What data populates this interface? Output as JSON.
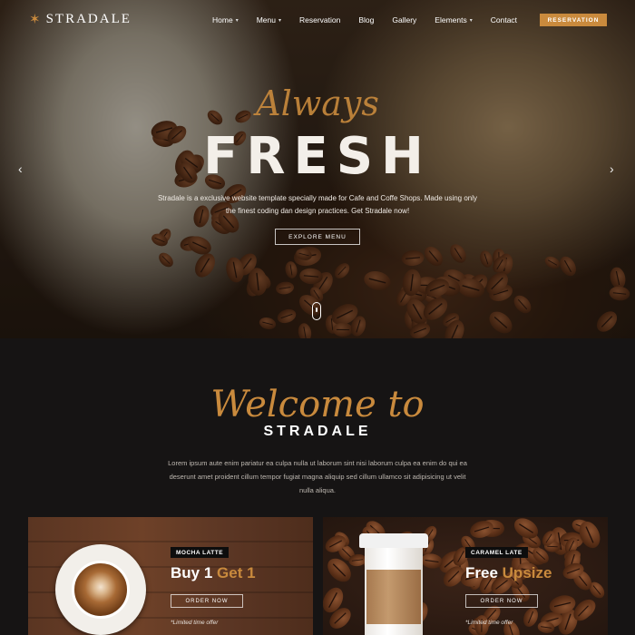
{
  "brand": {
    "name": "STRADALE"
  },
  "nav": {
    "items": [
      {
        "label": "Home",
        "dropdown": true
      },
      {
        "label": "Menu",
        "dropdown": true
      },
      {
        "label": "Reservation",
        "dropdown": false
      },
      {
        "label": "Blog",
        "dropdown": false
      },
      {
        "label": "Gallery",
        "dropdown": false
      },
      {
        "label": "Elements",
        "dropdown": true
      },
      {
        "label": "Contact",
        "dropdown": false
      }
    ],
    "cta_label": "RESERVATION"
  },
  "hero": {
    "script_word": "Always",
    "headline": "FRESH",
    "description": "Stradale is a exclusive website template specially made for Cafe and Coffe Shops. Made using only the finest coding dan design practices. Get Stradale now!",
    "button_label": "EXPLORE MENU"
  },
  "welcome": {
    "script_title": "Welcome to",
    "brand_title": "STRADALE",
    "text": "Lorem ipsum aute enim pariatur ea culpa nulla ut laborum sint nisi laborum culpa ea enim do qui ea deserunt amet proident cillum tempor fugiat magna aliquip sed cillum ullamco sit adipisicing ut velit nulla aliqua."
  },
  "offers": [
    {
      "tag": "MOCHA LATTE",
      "title_main": "Buy 1",
      "title_accent": "Get 1",
      "button_label": "ORDER NOW",
      "note": "*Limited time offer"
    },
    {
      "tag": "CARAMEL LATE",
      "title_main": "Free",
      "title_accent": "Upsize",
      "button_label": "ORDER NOW",
      "note": "*Limited time offer"
    }
  ],
  "colors": {
    "accent": "#c98a3d",
    "background": "#161414"
  },
  "icons": {
    "logo": "star-icon",
    "dropdown": "chevron-down-icon",
    "prev": "chevron-left-icon",
    "next": "chevron-right-icon",
    "scroll": "mouse-scroll-icon"
  }
}
